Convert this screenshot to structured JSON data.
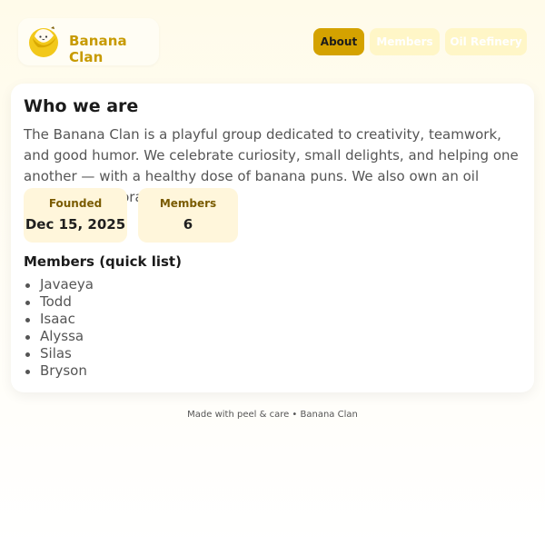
{
  "header": {
    "brand_name": "Banana Clan",
    "logo_icon": "banana-face-icon",
    "nav": [
      {
        "label": "About",
        "active": true
      },
      {
        "label": "Members",
        "active": false
      },
      {
        "label": "Oil Refinery",
        "active": false
      }
    ]
  },
  "about": {
    "title": "Who we are",
    "description": "The Banana Clan is a playful group dedicated to creativity, teamwork, and good humor. We celebrate curiosity, small delights, and helping one another — with a healthy dose of banana puns. We also own an oil refinery in Aurora.",
    "stats": [
      {
        "label": "Founded",
        "value": "Dec 15, 2025"
      },
      {
        "label": "Members",
        "value": "6"
      }
    ],
    "list_heading": "Members (quick list)",
    "members": [
      "Javaeya",
      "Todd",
      "Isaac",
      "Alyssa",
      "Silas",
      "Bryson"
    ]
  },
  "footer": {
    "text": "Made with peel & care • Banana Clan"
  },
  "colors": {
    "accent": "#d4a200",
    "brand_text": "#c79a00",
    "stat_background": "#fff6db",
    "page_background": "#fffbea"
  }
}
